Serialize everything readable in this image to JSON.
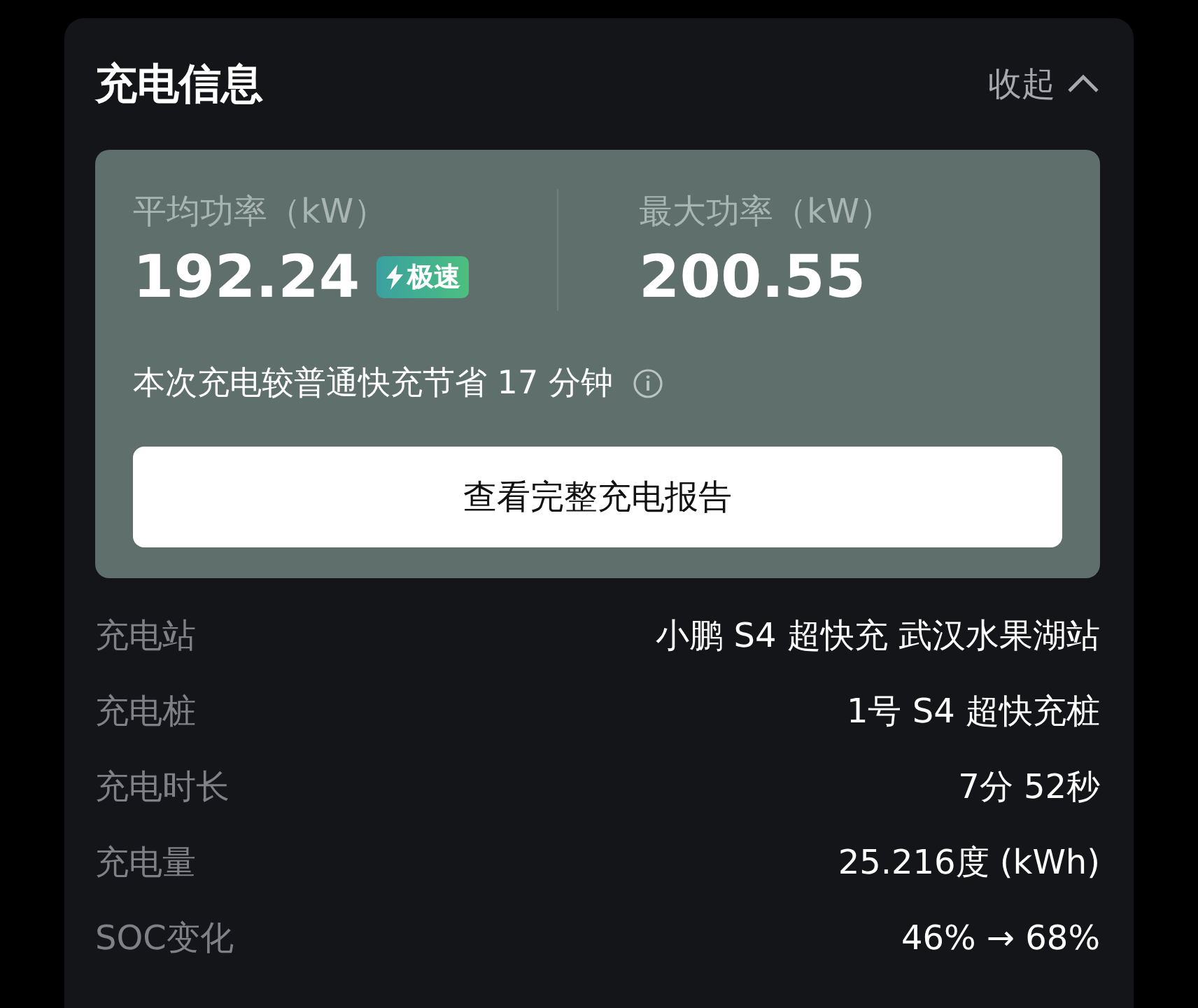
{
  "card": {
    "title": "充电信息",
    "collapse": {
      "label": "收起",
      "expanded": true
    }
  },
  "summary": {
    "stats": [
      {
        "label": "平均功率（kW）",
        "value": "192.24",
        "badge": "极速"
      },
      {
        "label": "最大功率（kW）",
        "value": "200.55"
      }
    ],
    "note": "本次充电较普通快充节省 17 分钟",
    "button": "查看完整充电报告"
  },
  "details": [
    {
      "label": "充电站",
      "value": "小鹏 S4 超快充 武汉水果湖站"
    },
    {
      "label": "充电桩",
      "value": "1号 S4 超快充桩"
    },
    {
      "label": "充电时长",
      "value": "7分 52秒"
    },
    {
      "label": "充电量",
      "value": "25.216度 (kWh)"
    },
    {
      "label": "SOC变化",
      "value": "46% → 68%"
    }
  ]
}
